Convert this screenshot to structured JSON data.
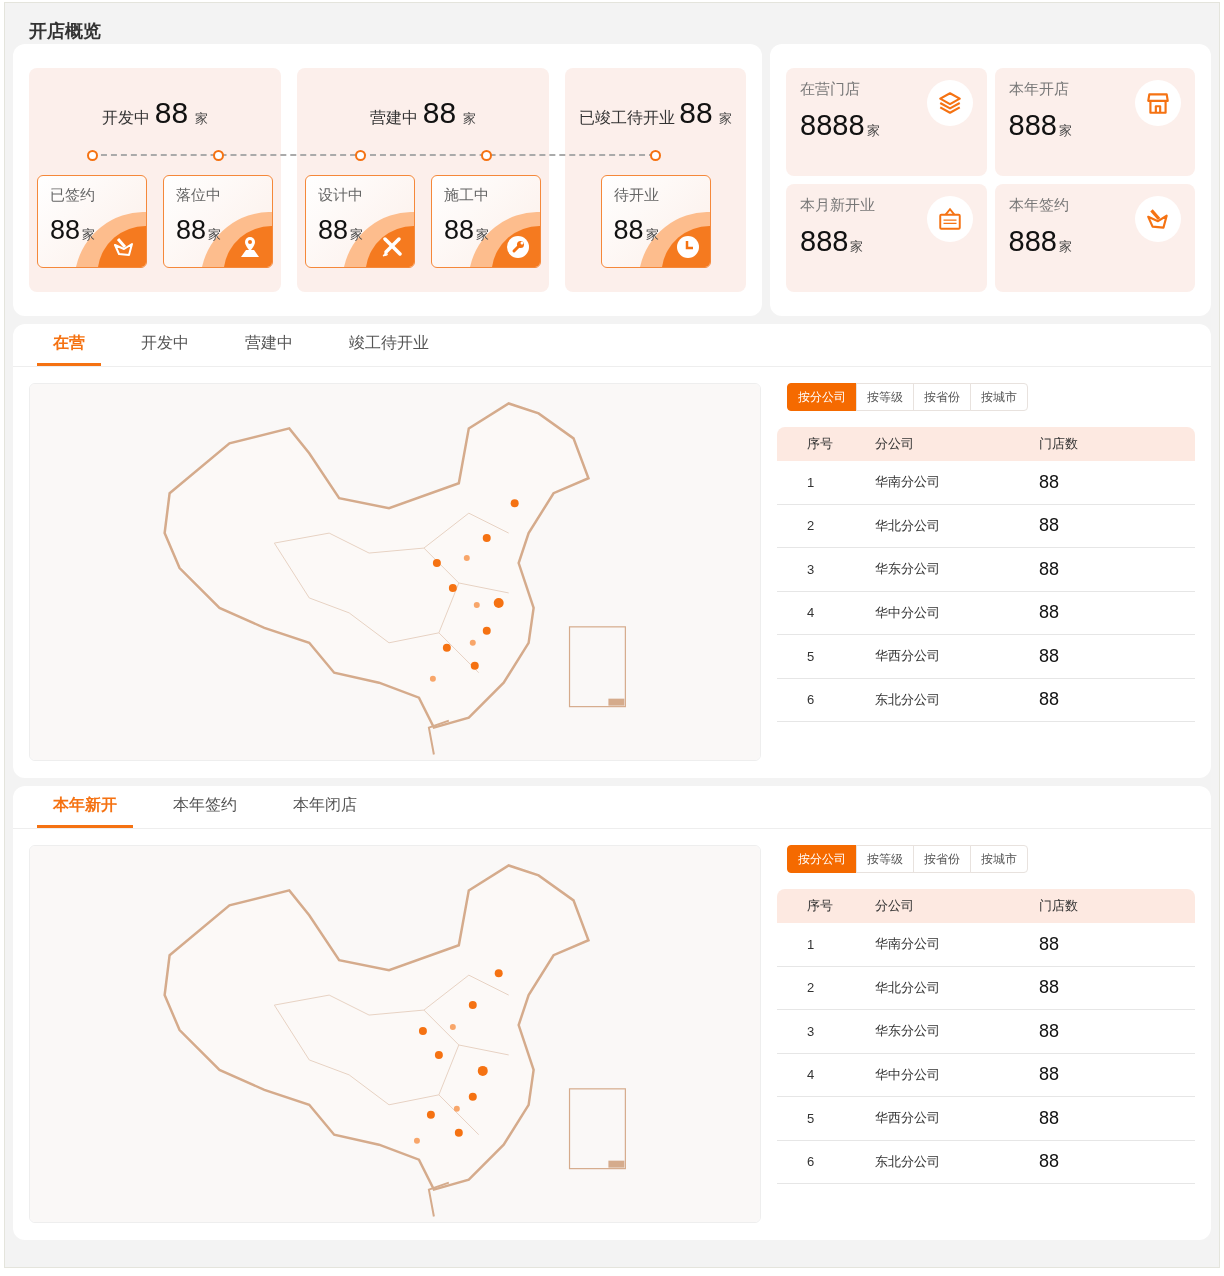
{
  "page_title": "开店概览",
  "stage_groups": [
    {
      "label": "开发中",
      "count": "88",
      "unit": "家",
      "stages": [
        {
          "label": "已签约",
          "count": "88",
          "unit": "家"
        },
        {
          "label": "落位中",
          "count": "88",
          "unit": "家"
        }
      ]
    },
    {
      "label": "营建中",
      "count": "88",
      "unit": "家",
      "stages": [
        {
          "label": "设计中",
          "count": "88",
          "unit": "家"
        },
        {
          "label": "施工中",
          "count": "88",
          "unit": "家"
        }
      ]
    },
    {
      "label": "已竣工待开业",
      "count": "88",
      "unit": "家",
      "stages": [
        {
          "label": "待开业",
          "count": "88",
          "unit": "家"
        }
      ]
    }
  ],
  "summary_cards": [
    {
      "label": "在营门店",
      "count": "8888",
      "unit": "家"
    },
    {
      "label": "本年开店",
      "count": "888",
      "unit": "家"
    },
    {
      "label": "本月新开业",
      "count": "888",
      "unit": "家"
    },
    {
      "label": "本年签约",
      "count": "888",
      "unit": "家"
    }
  ],
  "sections": [
    {
      "tabs": [
        {
          "label": "在营",
          "selected": true
        },
        {
          "label": "开发中",
          "selected": false
        },
        {
          "label": "营建中",
          "selected": false
        },
        {
          "label": "竣工待开业",
          "selected": false
        }
      ],
      "map": {
        "kind": "picture"
      },
      "filters": [
        {
          "label": "按分公司",
          "selected": true
        },
        {
          "label": "按等级",
          "selected": false
        },
        {
          "label": "按省份",
          "selected": false
        },
        {
          "label": "按城市",
          "selected": false
        }
      ],
      "table": {
        "columns": [
          "序号",
          "分公司",
          "门店数"
        ],
        "rows": [
          [
            "1",
            "华南分公司",
            "88"
          ],
          [
            "2",
            "华北分公司",
            "88"
          ],
          [
            "3",
            "华东分公司",
            "88"
          ],
          [
            "4",
            "华中分公司",
            "88"
          ],
          [
            "5",
            "华西分公司",
            "88"
          ],
          [
            "6",
            "东北分公司",
            "88"
          ]
        ]
      }
    },
    {
      "tabs": [
        {
          "label": "本年新开",
          "selected": true
        },
        {
          "label": "本年签约",
          "selected": false
        },
        {
          "label": "本年闭店",
          "selected": false
        }
      ],
      "map": {
        "kind": "picture"
      },
      "filters": [
        {
          "label": "按分公司",
          "selected": true
        },
        {
          "label": "按等级",
          "selected": false
        },
        {
          "label": "按省份",
          "selected": false
        },
        {
          "label": "按城市",
          "selected": false
        }
      ],
      "table": {
        "columns": [
          "序号",
          "分公司",
          "门店数"
        ],
        "rows": [
          [
            "1",
            "华南分公司",
            "88"
          ],
          [
            "2",
            "华北分公司",
            "88"
          ],
          [
            "3",
            "华东分公司",
            "88"
          ],
          [
            "4",
            "华中分公司",
            "88"
          ],
          [
            "5",
            "华西分公司",
            "88"
          ],
          [
            "6",
            "东北分公司",
            "88"
          ]
        ]
      }
    }
  ]
}
